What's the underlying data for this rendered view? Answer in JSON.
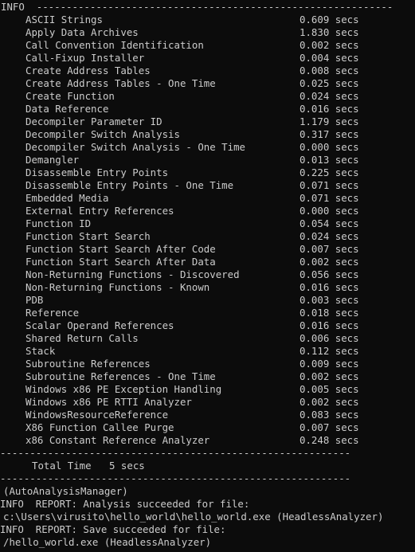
{
  "console": {
    "header": "INFO  ------------------------------------------------------------",
    "timings": [
      {
        "name": "ASCII Strings",
        "time": "0.609 secs"
      },
      {
        "name": "Apply Data Archives",
        "time": "1.830 secs"
      },
      {
        "name": "Call Convention Identification",
        "time": "0.002 secs"
      },
      {
        "name": "Call-Fixup Installer",
        "time": "0.004 secs"
      },
      {
        "name": "Create Address Tables",
        "time": "0.008 secs"
      },
      {
        "name": "Create Address Tables - One Time",
        "time": "0.025 secs"
      },
      {
        "name": "Create Function",
        "time": "0.024 secs"
      },
      {
        "name": "Data Reference",
        "time": "0.016 secs"
      },
      {
        "name": "Decompiler Parameter ID",
        "time": "1.179 secs"
      },
      {
        "name": "Decompiler Switch Analysis",
        "time": "0.317 secs"
      },
      {
        "name": "Decompiler Switch Analysis - One Time",
        "time": "0.000 secs"
      },
      {
        "name": "Demangler",
        "time": "0.013 secs"
      },
      {
        "name": "Disassemble Entry Points",
        "time": "0.225 secs"
      },
      {
        "name": "Disassemble Entry Points - One Time",
        "time": "0.071 secs"
      },
      {
        "name": "Embedded Media",
        "time": "0.071 secs"
      },
      {
        "name": "External Entry References",
        "time": "0.000 secs"
      },
      {
        "name": "Function ID",
        "time": "0.054 secs"
      },
      {
        "name": "Function Start Search",
        "time": "0.024 secs"
      },
      {
        "name": "Function Start Search After Code",
        "time": "0.007 secs"
      },
      {
        "name": "Function Start Search After Data",
        "time": "0.002 secs"
      },
      {
        "name": "Non-Returning Functions - Discovered",
        "time": "0.056 secs"
      },
      {
        "name": "Non-Returning Functions - Known",
        "time": "0.016 secs"
      },
      {
        "name": "PDB",
        "time": "0.003 secs"
      },
      {
        "name": "Reference",
        "time": "0.018 secs"
      },
      {
        "name": "Scalar Operand References",
        "time": "0.016 secs"
      },
      {
        "name": "Shared Return Calls",
        "time": "0.006 secs"
      },
      {
        "name": "Stack",
        "time": "0.112 secs"
      },
      {
        "name": "Subroutine References",
        "time": "0.009 secs"
      },
      {
        "name": "Subroutine References - One Time",
        "time": "0.002 secs"
      },
      {
        "name": "Windows x86 PE Exception Handling",
        "time": "0.005 secs"
      },
      {
        "name": "Windows x86 PE RTTI Analyzer",
        "time": "0.002 secs"
      },
      {
        "name": "WindowsResourceReference",
        "time": "0.083 secs"
      },
      {
        "name": "X86 Function Callee Purge",
        "time": "0.007 secs"
      },
      {
        "name": "x86 Constant Reference Analyzer",
        "time": "0.248 secs"
      }
    ],
    "separator_1": "-----------------------------------------------------------",
    "total_line": "Total Time   5 secs",
    "separator_2": "-----------------------------------------------------------",
    "manager_line": "(AutoAnalysisManager)",
    "report_line_1": "INFO  REPORT: Analysis succeeded for file:",
    "file_path_line": "c:\\Users\\virusito\\hello_world\\hello_world.exe (HeadlessAnalyzer)",
    "report_line_2": "INFO  REPORT: Save succeeded for file:",
    "saved_file_line": "/hello_world.exe (HeadlessAnalyzer)"
  }
}
